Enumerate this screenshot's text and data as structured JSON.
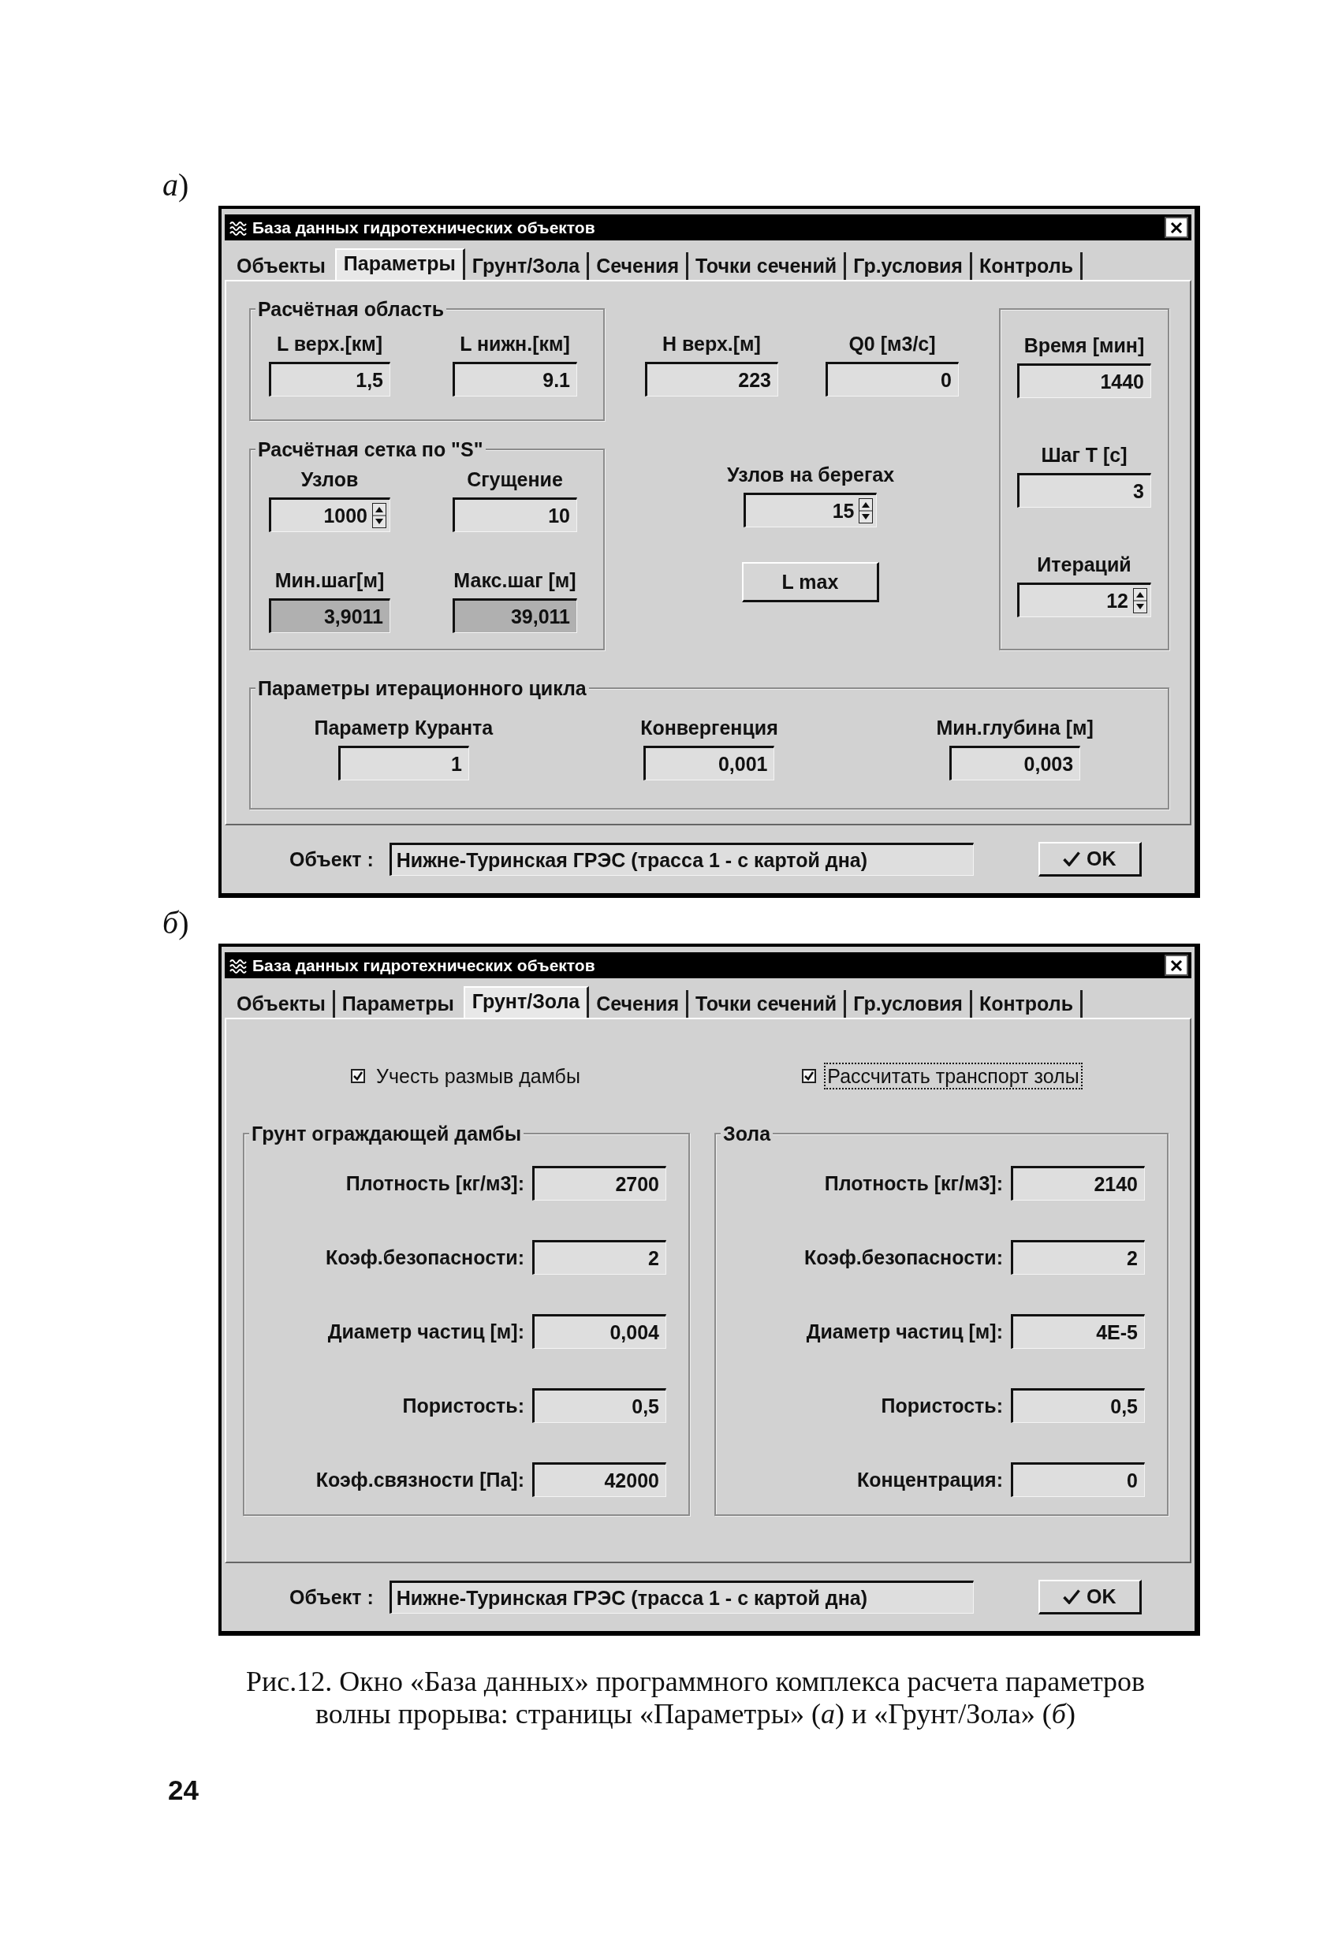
{
  "figures": [
    {
      "kind": "parameters",
      "label": "*а*)",
      "window": {
        "title": "База данных гидротехнических объектов",
        "tabs": [
          {
            "label": "Объекты",
            "selected": false
          },
          {
            "label": "Параметры",
            "selected": true
          },
          {
            "label": "Грунт/Зола",
            "selected": false
          },
          {
            "label": "Сечения",
            "selected": false
          },
          {
            "label": "Точки сечений",
            "selected": false
          },
          {
            "label": "Гр.условия",
            "selected": false
          },
          {
            "label": "Контроль",
            "selected": false
          }
        ],
        "calc_area": {
          "title": "Расчётная область",
          "fields": [
            {
              "label": "L верх.[км]",
              "value": "1,5"
            },
            {
              "label": "L нижн.[км]",
              "value": "9.1"
            }
          ]
        },
        "top_fields": [
          {
            "label": "H верх.[м]",
            "value": "223"
          },
          {
            "label": "Q0 [м3/с]",
            "value": "0"
          }
        ],
        "timing": {
          "fields": [
            {
              "label": "Время [мин]",
              "value": "1440",
              "kind": "text"
            },
            {
              "label": "Шаг T [с]",
              "value": "3",
              "kind": "text"
            },
            {
              "label": "Итераций",
              "value": "12",
              "kind": "spin"
            }
          ]
        },
        "grid": {
          "title": "Расчётная сетка по \"S\"",
          "fields": [
            {
              "label": "Узлов",
              "value": "1000",
              "kind": "spin",
              "readonly": false
            },
            {
              "label": "Сгущение",
              "value": "10",
              "kind": "text",
              "readonly": false
            },
            {
              "label": "Мин.шаг[м]",
              "value": "3,9011",
              "kind": "text",
              "readonly": true
            },
            {
              "label": "Макс.шаг [м]",
              "value": "39,011",
              "kind": "text",
              "readonly": true
            }
          ]
        },
        "bank_nodes": {
          "label": "Узлов на берегах",
          "value": "15",
          "kind": "spin"
        },
        "lmax_button": "L max",
        "iteration": {
          "title": "Параметры итерационного цикла",
          "fields": [
            {
              "label": "Параметр Куранта",
              "value": "1"
            },
            {
              "label": "Конвергенция",
              "value": "0,001"
            },
            {
              "label": "Мин.глубина [м]",
              "value": "0,003"
            }
          ]
        },
        "object": {
          "label": "Объект :",
          "value": "Нижне-Туринская ГРЭС (трасса 1 - с картой дна)"
        },
        "ok_button": "OK"
      }
    },
    {
      "kind": "soil",
      "label": "*б*)",
      "window": {
        "title": "База данных гидротехнических объектов",
        "tabs": [
          {
            "label": "Объекты",
            "selected": false
          },
          {
            "label": "Параметры",
            "selected": false
          },
          {
            "label": "Грунт/Зола",
            "selected": true
          },
          {
            "label": "Сечения",
            "selected": false
          },
          {
            "label": "Точки сечений",
            "selected": false
          },
          {
            "label": "Гр.условия",
            "selected": false
          },
          {
            "label": "Контроль",
            "selected": false
          }
        ],
        "checkboxes": [
          {
            "label": "Учесть размыв дамбы",
            "checked": true,
            "focused": false
          },
          {
            "label": "Рассчитать транспорт золы",
            "checked": true,
            "focused": true
          }
        ],
        "groups": [
          {
            "title": "Грунт ограждающей дамбы",
            "fields": [
              {
                "label": "Плотность [кг/м3]:",
                "value": "2700"
              },
              {
                "label": "Коэф.безопасности:",
                "value": "2"
              },
              {
                "label": "Диаметр частиц [м]:",
                "value": "0,004"
              },
              {
                "label": "Пористость:",
                "value": "0,5"
              },
              {
                "label": "Коэф.связности [Па]:",
                "value": "42000"
              }
            ]
          },
          {
            "title": "Зола",
            "fields": [
              {
                "label": "Плотность [кг/м3]:",
                "value": "2140"
              },
              {
                "label": "Коэф.безопасности:",
                "value": "2"
              },
              {
                "label": "Диаметр частиц [м]:",
                "value": "4E-5"
              },
              {
                "label": "Пористость:",
                "value": "0,5"
              },
              {
                "label": "Концентрация:",
                "value": "0"
              }
            ]
          }
        ],
        "object": {
          "label": "Объект :",
          "value": "Нижне-Туринская ГРЭС (трасса 1 - с картой дна)"
        },
        "ok_button": "OK"
      }
    }
  ],
  "caption": "Рис.12. Окно «База данных» программного комплекса расчета параметров\nволны прорыва: страницы «Параметры» (*а*) и «Грунт/Зола» (*б*)",
  "page_number": "24"
}
